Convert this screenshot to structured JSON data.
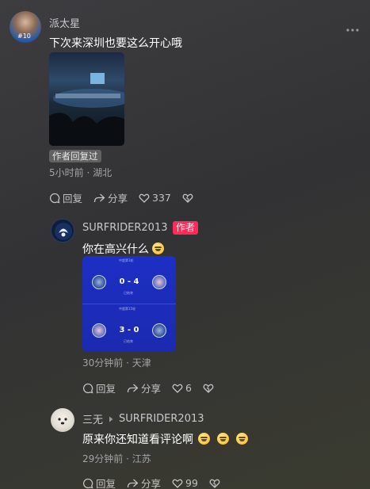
{
  "colors": {
    "author_tag": "#ff2a55",
    "background": "#363638",
    "link_card": "#1b2ab0"
  },
  "more_icon": "more-dots-icon",
  "comments": [
    {
      "username": "派太星",
      "text": "下次来深圳也要这么开心哦",
      "reply_badge": "作者回复过",
      "meta": "5小时前 · 湖北",
      "reply_label": "回复",
      "share_label": "分享",
      "likes": "337"
    },
    {
      "username": "SURFRIDER2013",
      "author_tag": "作者",
      "text": "你在高兴什么",
      "meta": "30分钟前 · 天津",
      "reply_label": "回复",
      "share_label": "分享",
      "likes": "6",
      "scorecard": {
        "match1": {
          "header": "中超第1轮",
          "score": "0 - 4",
          "status": "已结束"
        },
        "match2": {
          "header": "中超第15轮",
          "score": "3 - 0",
          "status": "已结束"
        }
      }
    },
    {
      "username": "三无",
      "reply_to": "SURFRIDER2013",
      "text": "原来你还知道看评论啊",
      "meta": "29分钟前 · 江苏",
      "reply_label": "回复",
      "share_label": "分享",
      "likes": "99"
    }
  ]
}
